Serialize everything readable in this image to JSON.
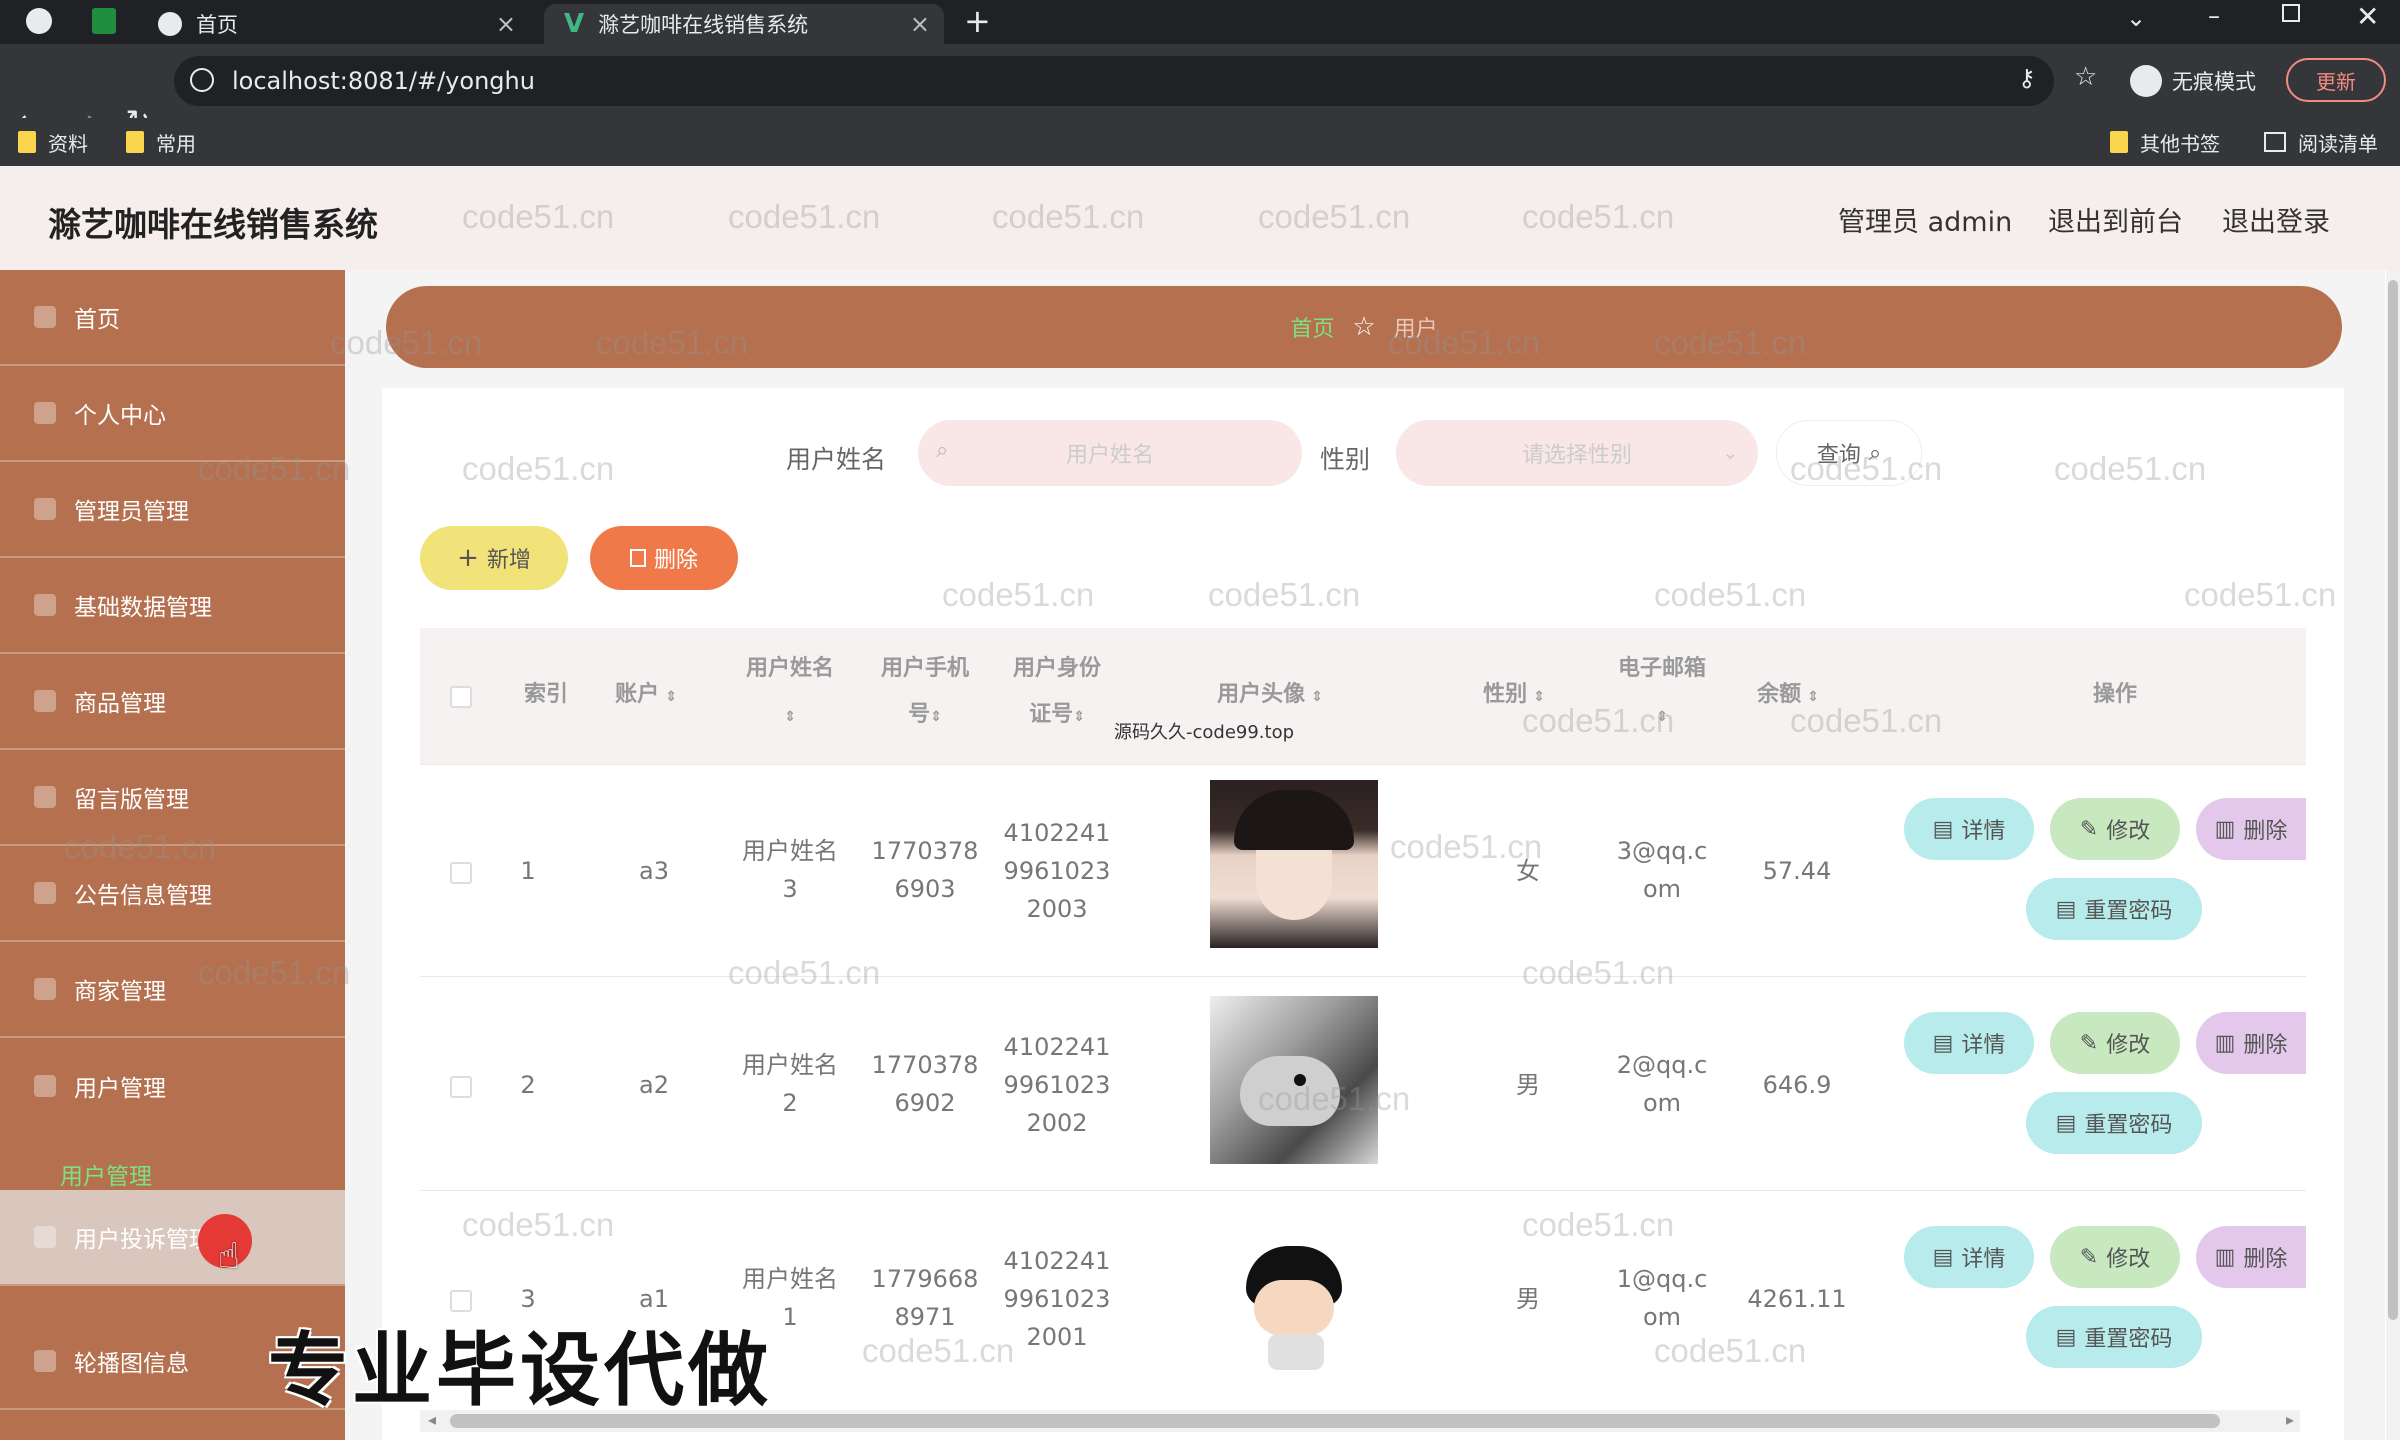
{
  "browser": {
    "tabs": [
      {
        "label": "首页"
      },
      {
        "label": "滁艺咖啡在线销售系统"
      }
    ],
    "new_tab": "+",
    "url": "localhost:8081/#/yonghu",
    "profile_label": "无痕模式",
    "update_label": "更新",
    "bookmarks": [
      "资料",
      "常用"
    ],
    "bookmarks_right": [
      "其他书签",
      "阅读清单"
    ]
  },
  "app": {
    "title": "滁艺咖啡在线销售系统",
    "admin_label": "管理员 admin",
    "to_front": "退出到前台",
    "logout": "退出登录"
  },
  "sidebar": {
    "items": [
      {
        "label": "首页"
      },
      {
        "label": "个人中心"
      },
      {
        "label": "管理员管理"
      },
      {
        "label": "基础数据管理"
      },
      {
        "label": "商品管理"
      },
      {
        "label": "留言版管理"
      },
      {
        "label": "公告信息管理"
      },
      {
        "label": "商家管理"
      },
      {
        "label": "用户管理"
      }
    ],
    "sub_item": "用户管理",
    "hover_item": "用户投诉管理",
    "last_item": "轮播图信息"
  },
  "breadcrumb": {
    "home": "首页",
    "current": "用户"
  },
  "search": {
    "name_label": "用户姓名",
    "name_placeholder": "用户姓名",
    "gender_label": "性别",
    "gender_placeholder": "请选择性别",
    "query_label": "查询"
  },
  "actions": {
    "add": "新增",
    "delete": "删除"
  },
  "table": {
    "headers": {
      "index": "索引",
      "account": "账户",
      "name": "用户姓名",
      "phone": "用户手机号",
      "idcard": "用户身份证号",
      "avatar": "用户头像",
      "gender": "性别",
      "email": "电子邮箱",
      "balance": "余额",
      "ops": "操作"
    },
    "rows": [
      {
        "index": "1",
        "account": "a3",
        "name1": "用户姓名",
        "name2": "3",
        "phone1": "1770378",
        "phone2": "6903",
        "id1": "4102241",
        "id2": "9961023",
        "id3": "2003",
        "gender": "女",
        "email1": "3@qq.c",
        "email2": "om",
        "balance": "57.44"
      },
      {
        "index": "2",
        "account": "a2",
        "name1": "用户姓名",
        "name2": "2",
        "phone1": "1770378",
        "phone2": "6902",
        "id1": "4102241",
        "id2": "9961023",
        "id3": "2002",
        "gender": "男",
        "email1": "2@qq.c",
        "email2": "om",
        "balance": "646.9"
      },
      {
        "index": "3",
        "account": "a1",
        "name1": "用户姓名",
        "name2": "1",
        "phone1": "1779668",
        "phone2": "8971",
        "id1": "4102241",
        "id2": "9961023",
        "id3": "2001",
        "gender": "男",
        "email1": "1@qq.c",
        "email2": "om",
        "balance": "4261.11"
      }
    ],
    "op_labels": {
      "detail": "详情",
      "edit": "修改",
      "delete": "删除",
      "reset": "重置密码"
    }
  },
  "overlay": {
    "watermark": "code51.cn",
    "code_mark": "源码久久-code99.top",
    "promo": "专业毕设代做"
  },
  "colors": {
    "sidebar": "#b4704f",
    "accent_green": "#7fe07f",
    "add_button": "#f2e27a",
    "delete_button": "#f0794a"
  }
}
